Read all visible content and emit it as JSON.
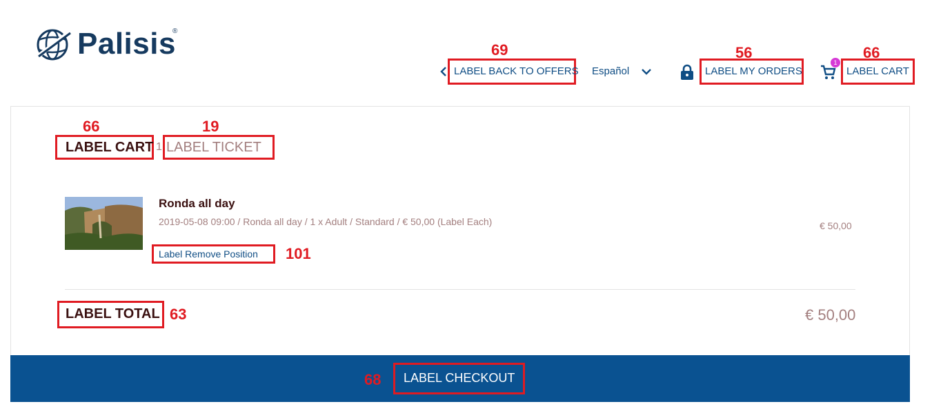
{
  "brand": {
    "name": "Palisis",
    "registered": "®"
  },
  "header": {
    "back_to_offers": "LABEL BACK TO OFFERS",
    "language": "Español",
    "my_orders": "LABEL MY ORDERS",
    "cart": "LABEL CART",
    "cart_count": "1"
  },
  "breadcrumb": {
    "cart": "LABEL CART",
    "step_number": "1",
    "ticket": "LABEL TICKET"
  },
  "cart_item": {
    "name": "Ronda all day",
    "details": "2019-05-08 09:00 / Ronda all day / 1 x Adult / Standard / € 50,00 (Label Each)",
    "price": "€ 50,00",
    "remove_label": "Label Remove Position"
  },
  "total": {
    "label": "LABEL TOTAL",
    "value": "€ 50,00"
  },
  "checkout": {
    "label": "LABEL CHECKOUT"
  },
  "annotations": {
    "back_to_offers": "69",
    "my_orders": "56",
    "header_cart": "66",
    "breadcrumb_cart": "66",
    "ticket": "19",
    "remove": "101",
    "total": "63",
    "checkout": "68"
  },
  "colors": {
    "brand_blue": "#163a5f",
    "link_blue": "#0f4d84",
    "checkout_bar": "#0a5291",
    "annotation_red": "#e01b22",
    "badge": "#d63ad6"
  }
}
